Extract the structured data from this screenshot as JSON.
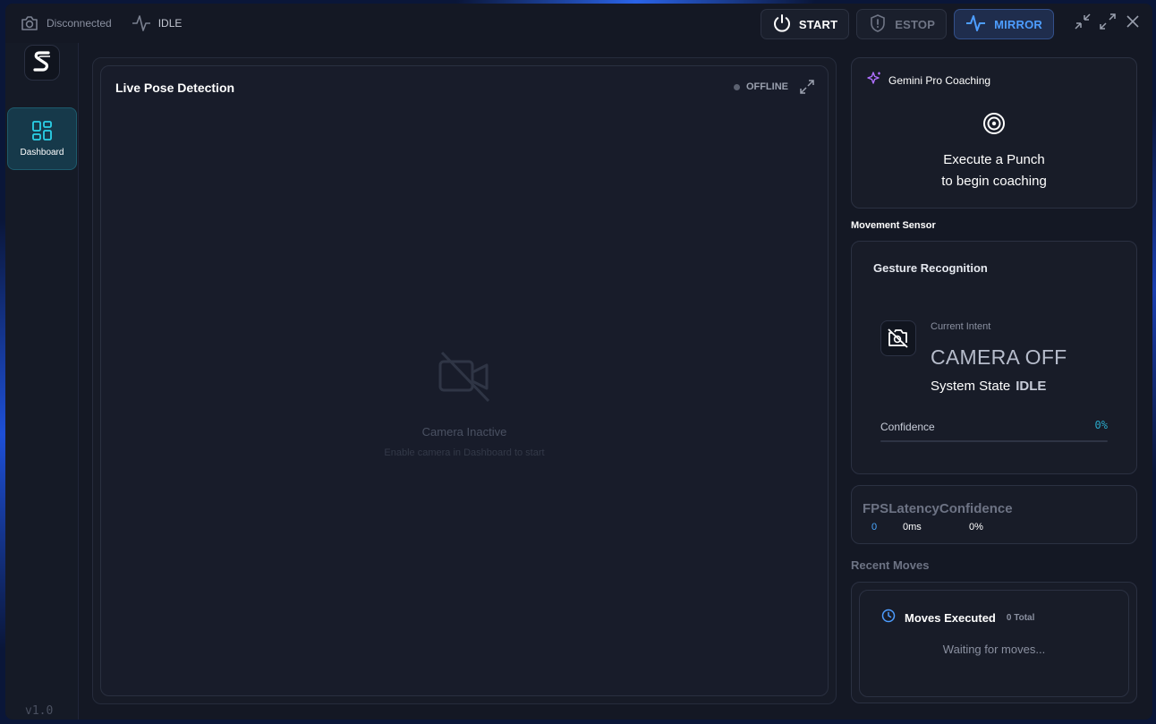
{
  "status": {
    "connection": "Disconnected",
    "state": "IDLE"
  },
  "controls": {
    "start": "START",
    "estop": "ESTOP",
    "mirror": "MIRROR"
  },
  "sidebar": {
    "dashboard": "Dashboard",
    "version": "v1.0"
  },
  "main": {
    "title": "Live Pose Detection",
    "status": "OFFLINE",
    "camera_title": "Camera Inactive",
    "camera_hint": "Enable camera in Dashboard to start"
  },
  "gemini": {
    "title": "Gemini Pro Coaching",
    "message_line1": "Execute a Punch",
    "message_line2": "to begin coaching"
  },
  "sensor": {
    "section_label": "Movement Sensor",
    "title": "Gesture Recognition",
    "intent_label": "Current Intent",
    "intent_value": "CAMERA OFF",
    "state_label": "System State",
    "state_value": "IDLE",
    "confidence_label": "Confidence",
    "confidence_value": "0%",
    "confidence_fraction": 0
  },
  "stats": {
    "fps_label": "FPS",
    "latency_label": "Latency",
    "confidence_label": "Confidence",
    "fps_value": "0",
    "latency_value": "0ms",
    "confidence_value": "0%"
  },
  "recent": {
    "label": "Recent Moves",
    "title": "Moves Executed",
    "count": "0 Total",
    "empty": "Waiting for moves..."
  },
  "colors": {
    "accent_cyan": "#2aa8c8",
    "accent_blue": "#4d9dff",
    "gemini_purple": "#b070ff"
  }
}
